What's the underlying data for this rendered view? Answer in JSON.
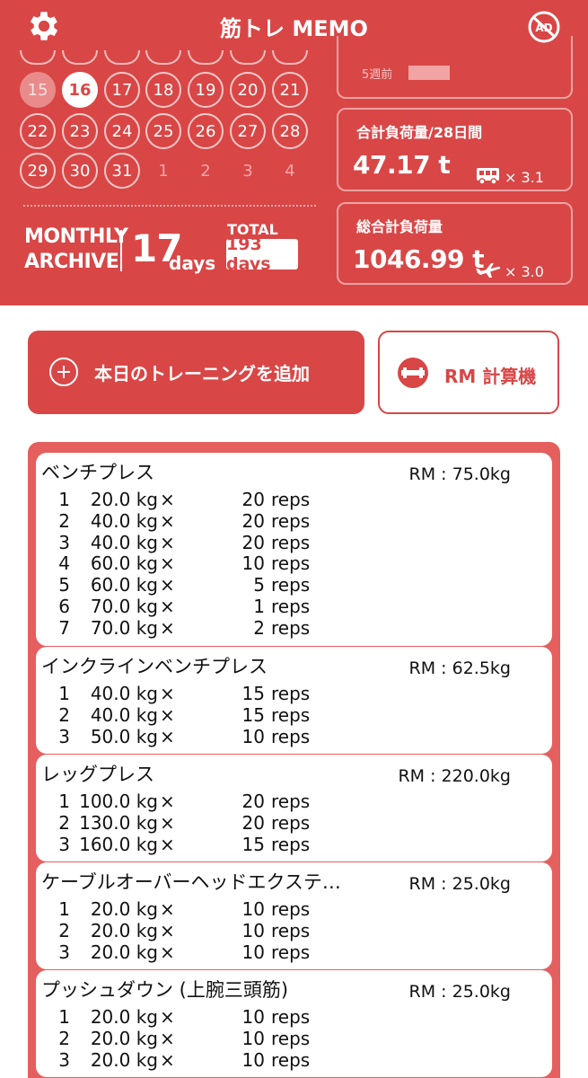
{
  "header": {
    "title": "筋トレ MEMO",
    "settings_icon": "gear-icon",
    "ad_icon": "no-ad-icon"
  },
  "calendar": {
    "rows": [
      [
        {
          "d": "15",
          "s": "past"
        },
        {
          "d": "16",
          "s": "today"
        },
        {
          "d": "17",
          "s": ""
        },
        {
          "d": "18",
          "s": ""
        },
        {
          "d": "19",
          "s": ""
        },
        {
          "d": "20",
          "s": ""
        },
        {
          "d": "21",
          "s": ""
        }
      ],
      [
        {
          "d": "22",
          "s": ""
        },
        {
          "d": "23",
          "s": ""
        },
        {
          "d": "24",
          "s": ""
        },
        {
          "d": "25",
          "s": ""
        },
        {
          "d": "26",
          "s": ""
        },
        {
          "d": "27",
          "s": ""
        },
        {
          "d": "28",
          "s": ""
        }
      ],
      [
        {
          "d": "29",
          "s": ""
        },
        {
          "d": "30",
          "s": ""
        },
        {
          "d": "31",
          "s": ""
        },
        {
          "d": "1",
          "s": "next"
        },
        {
          "d": "2",
          "s": "next"
        },
        {
          "d": "3",
          "s": "next"
        },
        {
          "d": "4",
          "s": "next"
        }
      ]
    ]
  },
  "archive": {
    "label": "MONTHLY ARCHIVE",
    "month_count": "17",
    "month_unit": "days",
    "total_label": "TOTAL",
    "total_value": "193 days"
  },
  "stats": {
    "weeks_ago_label": "5週前",
    "load28_label": "合計負荷量/28日間",
    "load28_value": "47.17 t",
    "load28_icon": "bus-icon",
    "load28_mult": "× 3.1",
    "total_label": "総合計負荷量",
    "total_value": "1046.99 t",
    "total_icon": "airplane-icon",
    "total_mult": "× 3.0"
  },
  "actions": {
    "add_label": "本日のトレーニングを追加",
    "rm_label": "RM 計算機"
  },
  "exercises": [
    {
      "name": "ベンチプレス",
      "rm": "RM : 75.0kg",
      "sets": [
        {
          "i": "1",
          "w": "20.0 kg",
          "r": "20",
          "u": "reps"
        },
        {
          "i": "2",
          "w": "40.0 kg",
          "r": "20",
          "u": "reps"
        },
        {
          "i": "3",
          "w": "40.0 kg",
          "r": "20",
          "u": "reps"
        },
        {
          "i": "4",
          "w": "60.0 kg",
          "r": "10",
          "u": "reps"
        },
        {
          "i": "5",
          "w": "60.0 kg",
          "r": "5",
          "u": "reps"
        },
        {
          "i": "6",
          "w": "70.0 kg",
          "r": "1",
          "u": "reps"
        },
        {
          "i": "7",
          "w": "70.0 kg",
          "r": "2",
          "u": "reps"
        }
      ]
    },
    {
      "name": "インクラインベンチプレス",
      "rm": "RM : 62.5kg",
      "sets": [
        {
          "i": "1",
          "w": "40.0 kg",
          "r": "15",
          "u": "reps"
        },
        {
          "i": "2",
          "w": "40.0 kg",
          "r": "15",
          "u": "reps"
        },
        {
          "i": "3",
          "w": "50.0 kg",
          "r": "10",
          "u": "reps"
        }
      ]
    },
    {
      "name": "レッグプレス",
      "rm": "RM : 220.0kg",
      "sets": [
        {
          "i": "1",
          "w": "100.0 kg",
          "r": "20",
          "u": "reps"
        },
        {
          "i": "2",
          "w": "130.0 kg",
          "r": "20",
          "u": "reps"
        },
        {
          "i": "3",
          "w": "160.0 kg",
          "r": "15",
          "u": "reps"
        }
      ]
    },
    {
      "name": "ケーブルオーバーヘッドエクステ…",
      "rm": "RM : 25.0kg",
      "sets": [
        {
          "i": "1",
          "w": "20.0 kg",
          "r": "10",
          "u": "reps"
        },
        {
          "i": "2",
          "w": "20.0 kg",
          "r": "10",
          "u": "reps"
        },
        {
          "i": "3",
          "w": "20.0 kg",
          "r": "10",
          "u": "reps"
        }
      ]
    },
    {
      "name": "プッシュダウン (上腕三頭筋)",
      "rm": "RM : 25.0kg",
      "sets": [
        {
          "i": "1",
          "w": "20.0 kg",
          "r": "10",
          "u": "reps"
        },
        {
          "i": "2",
          "w": "20.0 kg",
          "r": "10",
          "u": "reps"
        },
        {
          "i": "3",
          "w": "20.0 kg",
          "r": "10",
          "u": "reps"
        }
      ]
    }
  ],
  "colors": {
    "brand": "#d94646",
    "panel": "#e55f5f"
  }
}
